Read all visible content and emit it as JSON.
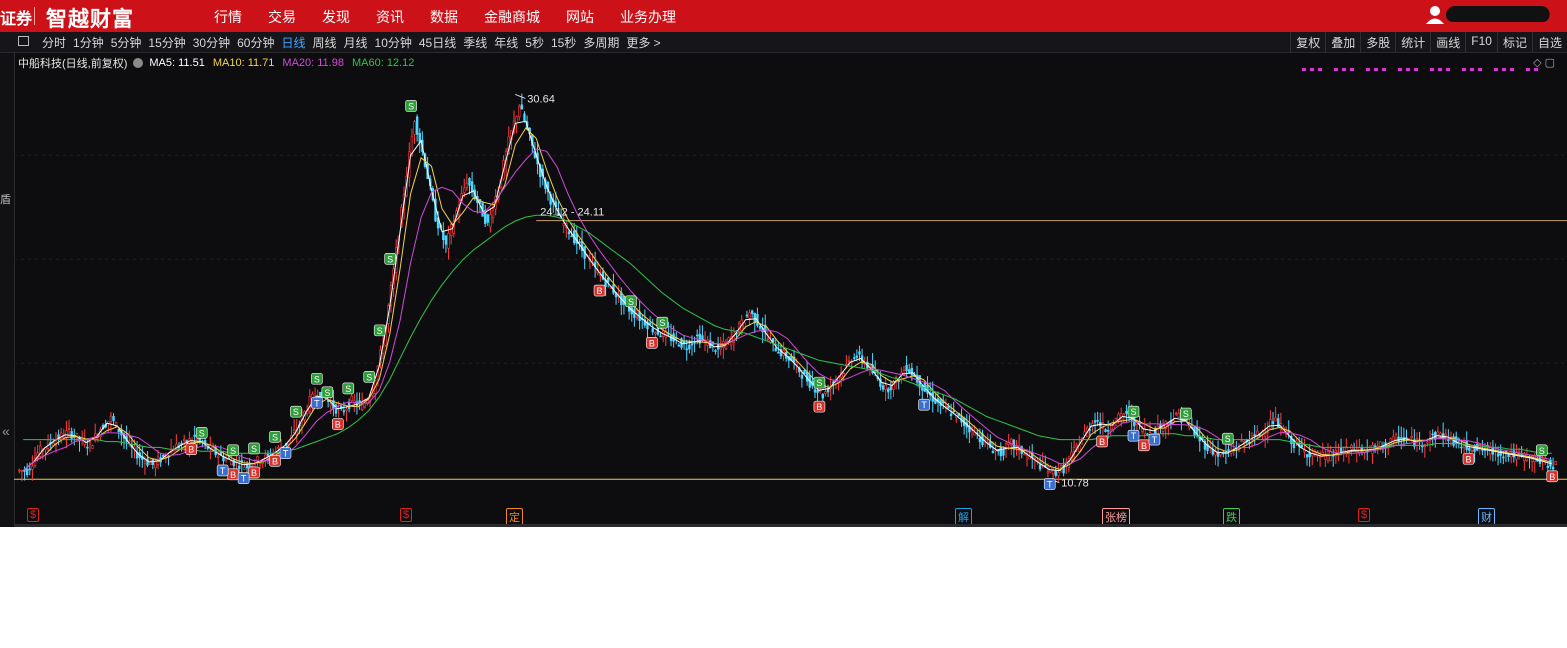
{
  "topbar": {
    "brand_left": "证券",
    "brand": "智越财富",
    "nav": [
      "行情",
      "交易",
      "发现",
      "资讯",
      "数据",
      "金融商城",
      "网站",
      "业务办理"
    ]
  },
  "toolbar": {
    "periods": [
      "分时",
      "1分钟",
      "5分钟",
      "15分钟",
      "30分钟",
      "60分钟",
      "日线",
      "周线",
      "月线",
      "10分钟",
      "45日线",
      "季线",
      "年线",
      "5秒",
      "15秒",
      "多周期",
      "更多 >"
    ],
    "active_period": "日线",
    "tools": [
      "复权",
      "叠加",
      "多股",
      "统计",
      "画线",
      "F10",
      "标记",
      "自选"
    ]
  },
  "legend": {
    "stock": "中船科技(日线,前复权)",
    "ma": [
      {
        "label": "MA5: 11.51",
        "color": "#ffffff"
      },
      {
        "label": "MA10: 11.71",
        "color": "#f2d34a"
      },
      {
        "label": "MA20: 11.98",
        "color": "#d04bd8"
      },
      {
        "label": "MA60: 12.12",
        "color": "#2fc34a"
      }
    ]
  },
  "chart_data": {
    "type": "candlestick",
    "title": "中船科技(日线,前复权)",
    "annotations": {
      "high": "30.64",
      "low": "10.78",
      "hline": "24.12 - 24.11"
    },
    "high_value": 30.64,
    "low_value": 10.78,
    "hline_value": 24.12,
    "ylim": [
      10.3,
      31.8
    ],
    "close": [
      11.2,
      12.1,
      12.6,
      12.9,
      13.2,
      12.8,
      12.5,
      13.4,
      13.9,
      13.1,
      12.3,
      11.8,
      11.5,
      11.9,
      12.4,
      12.6,
      12.9,
      12.5,
      12.1,
      11.8,
      11.6,
      11.4,
      11.7,
      11.9,
      12.3,
      12.7,
      13.6,
      14.8,
      15.3,
      14.6,
      14.2,
      14.8,
      14.5,
      15.4,
      17.8,
      21.5,
      25.6,
      29.4,
      27.1,
      24.3,
      22.8,
      24.6,
      26.2,
      25.1,
      23.9,
      25.8,
      28.2,
      30.1,
      28.4,
      26.6,
      25.2,
      24.1,
      23.4,
      22.6,
      21.8,
      21.1,
      20.5,
      19.8,
      19.3,
      18.9,
      18.4,
      18.2,
      17.9,
      17.6,
      18.1,
      17.8,
      17.4,
      17.9,
      18.6,
      19.4,
      18.7,
      17.8,
      17.3,
      16.9,
      16.2,
      15.6,
      15.1,
      15.8,
      16.4,
      17.2,
      16.8,
      16.1,
      15.4,
      15.8,
      16.6,
      15.9,
      15.2,
      14.7,
      14.3,
      13.9,
      13.4,
      12.9,
      12.4,
      12.1,
      12.6,
      12.2,
      11.8,
      11.4,
      11.1,
      11.3,
      12.2,
      13.1,
      13.9,
      13.3,
      13.8,
      14.2,
      13.6,
      13.1,
      13.4,
      13.7,
      14.1,
      13.5,
      12.8,
      12.3,
      12.0,
      12.2,
      12.6,
      12.9,
      13.2,
      13.8,
      13.3,
      12.6,
      12.2,
      12.0,
      11.9,
      12.1,
      12.2,
      12.3,
      12.2,
      12.4,
      12.6,
      12.9,
      12.8,
      12.6,
      12.9,
      13.1,
      12.8,
      12.5,
      12.4,
      12.3,
      12.2,
      12.1,
      12.0,
      11.9,
      11.8,
      11.6,
      11.5
    ],
    "ma60": [
      12.8,
      12.8,
      12.8,
      12.8,
      12.8,
      12.8,
      12.8,
      12.8,
      12.7,
      12.7,
      12.6,
      12.5,
      12.4,
      12.4,
      12.3,
      12.3,
      12.3,
      12.2,
      12.2,
      12.2,
      12.1,
      12.1,
      12.1,
      12.1,
      12.1,
      12.2,
      12.3,
      12.5,
      12.7,
      12.9,
      13.1,
      13.4,
      13.8,
      14.3,
      15.0,
      15.9,
      17.0,
      18.1,
      19.1,
      20.0,
      20.8,
      21.5,
      22.1,
      22.6,
      23.0,
      23.4,
      23.8,
      24.1,
      24.3,
      24.4,
      24.4,
      24.3,
      24.1,
      23.8,
      23.5,
      23.1,
      22.7,
      22.3,
      21.9,
      21.4,
      20.9,
      20.4,
      20.0,
      19.6,
      19.3,
      19.0,
      18.7,
      18.5,
      18.4,
      18.3,
      18.1,
      17.9,
      17.7,
      17.5,
      17.3,
      17.1,
      16.9,
      16.8,
      16.7,
      16.6,
      16.5,
      16.4,
      16.2,
      16.0,
      15.9,
      15.7,
      15.5,
      15.3,
      15.1,
      14.9,
      14.6,
      14.3,
      14.0,
      13.8,
      13.6,
      13.4,
      13.2,
      13.0,
      12.9,
      12.8,
      12.8,
      12.8,
      12.8,
      12.9,
      13.0,
      13.0,
      13.0,
      13.0,
      13.1,
      13.1,
      13.1,
      13.0,
      13.0,
      12.9,
      12.8,
      12.8,
      12.8,
      12.8,
      12.8,
      12.8,
      12.8,
      12.7,
      12.6,
      12.5,
      12.4,
      12.4,
      12.4,
      12.4,
      12.4,
      12.4,
      12.4,
      12.5,
      12.5,
      12.5,
      12.5,
      12.6,
      12.6,
      12.6,
      12.5,
      12.5,
      12.4,
      12.4,
      12.3,
      12.3,
      12.2,
      12.1,
      12.1
    ],
    "signals": [
      {
        "type": "B",
        "idx": 16
      },
      {
        "type": "S",
        "idx": 17
      },
      {
        "type": "B",
        "idx": 20
      },
      {
        "type": "S",
        "idx": 20
      },
      {
        "type": "T",
        "idx": 19
      },
      {
        "type": "B",
        "idx": 22
      },
      {
        "type": "S",
        "idx": 22
      },
      {
        "type": "T",
        "idx": 21
      },
      {
        "type": "B",
        "idx": 24
      },
      {
        "type": "S",
        "idx": 24
      },
      {
        "type": "T",
        "idx": 25
      },
      {
        "type": "S",
        "idx": 26
      },
      {
        "type": "S",
        "idx": 28
      },
      {
        "type": "T",
        "idx": 28
      },
      {
        "type": "S",
        "idx": 29
      },
      {
        "type": "B",
        "idx": 30
      },
      {
        "type": "S",
        "idx": 31
      },
      {
        "type": "S",
        "idx": 33
      },
      {
        "type": "S",
        "idx": 34
      },
      {
        "type": "S",
        "idx": 35
      },
      {
        "type": "S",
        "idx": 37
      },
      {
        "type": "B",
        "idx": 55
      },
      {
        "type": "S",
        "idx": 58
      },
      {
        "type": "S",
        "idx": 61
      },
      {
        "type": "B",
        "idx": 60
      },
      {
        "type": "S",
        "idx": 76
      },
      {
        "type": "B",
        "idx": 76
      },
      {
        "type": "T",
        "idx": 86
      },
      {
        "type": "T",
        "idx": 98
      },
      {
        "type": "B",
        "idx": 103
      },
      {
        "type": "S",
        "idx": 106
      },
      {
        "type": "B",
        "idx": 107
      },
      {
        "type": "T",
        "idx": 106
      },
      {
        "type": "T",
        "idx": 108
      },
      {
        "type": "S",
        "idx": 111
      },
      {
        "type": "S",
        "idx": 115
      },
      {
        "type": "B",
        "idx": 138
      },
      {
        "type": "S",
        "idx": 145
      },
      {
        "type": "B",
        "idx": 146
      },
      {
        "type": "S",
        "idx": 148
      }
    ]
  },
  "events": [
    {
      "label": "$",
      "color": "#e02020"
    },
    {
      "label": "$",
      "color": "#e02020"
    },
    {
      "label": "定",
      "color": "#f08a1c"
    },
    {
      "label": "解",
      "color": "#1ea0e0"
    },
    {
      "label": "张榜",
      "color": "#ff9b9b"
    },
    {
      "label": "跌",
      "color": "#3cd04a"
    },
    {
      "label": "$",
      "color": "#e02020"
    },
    {
      "label": "财",
      "color": "#6ab8ff"
    }
  ]
}
